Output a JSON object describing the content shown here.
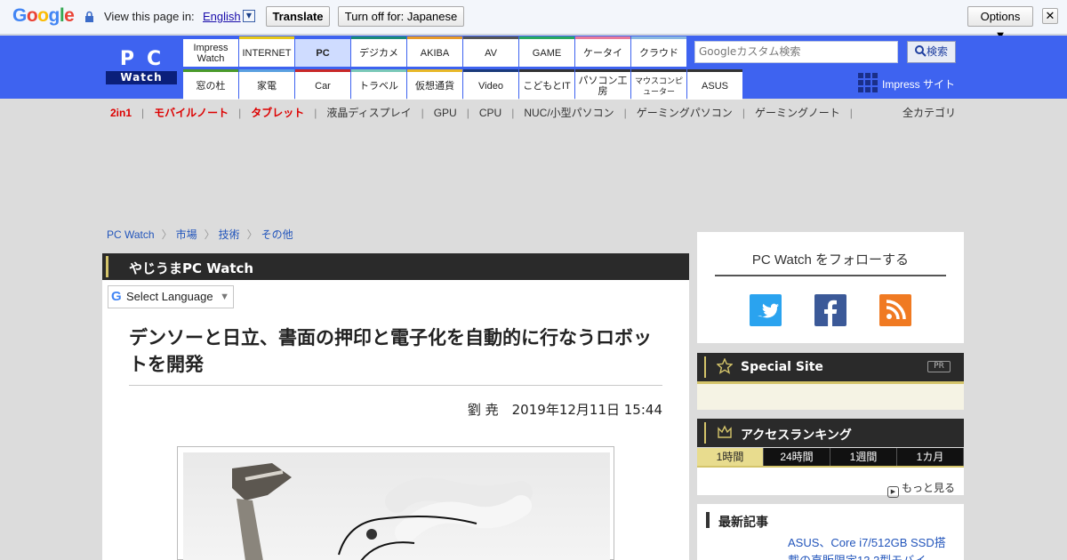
{
  "translate_bar": {
    "logo": "Google",
    "view_label": "View this page in:",
    "language": "English",
    "translate_btn": "Translate",
    "turn_off_btn": "Turn off for: Japanese",
    "options_btn": "Options ▼",
    "close_btn": "✕"
  },
  "header": {
    "logo_top": "PC",
    "logo_bottom": "Watch",
    "nav_top": [
      {
        "label": "Impress Watch",
        "color": "#3e63f0"
      },
      {
        "label": "INTERNET",
        "color": "#e8c818"
      },
      {
        "label": "PC",
        "color": "#3e63f0"
      },
      {
        "label": "デジカメ",
        "color": "#1a8a78"
      },
      {
        "label": "AKIBA",
        "color": "#e89a28"
      },
      {
        "label": "AV",
        "color": "#555555"
      },
      {
        "label": "GAME",
        "color": "#28a860"
      },
      {
        "label": "ケータイ",
        "color": "#e87a9a"
      },
      {
        "label": "クラウド",
        "color": "#8ab8e0"
      }
    ],
    "nav_bottom": [
      {
        "label": "窓の杜",
        "color": "#4a9a2a"
      },
      {
        "label": "家電",
        "color": "#5aa0e0"
      },
      {
        "label": "Car",
        "color": "#c82828"
      },
      {
        "label": "トラベル",
        "color": "#7ac8b8"
      },
      {
        "label": "仮想通貨",
        "color": "#e8b828"
      },
      {
        "label": "Video",
        "color": "#1a3a7a"
      },
      {
        "label": "こどもとIT",
        "color": "#333333"
      },
      {
        "label": "パソコン工房",
        "color": "#333333"
      },
      {
        "label": "マウスコンピューター",
        "color": "#333333"
      },
      {
        "label": "ASUS",
        "color": "#333333"
      }
    ],
    "search_placeholder": "Googleカスタム検索",
    "search_btn": "検索",
    "impress_site": "Impress サイト"
  },
  "categories": [
    {
      "label": "2in1",
      "highlight": true
    },
    {
      "label": "モバイルノート",
      "highlight": true
    },
    {
      "label": "タブレット",
      "highlight": true
    },
    {
      "label": "液晶ディスプレイ",
      "highlight": false
    },
    {
      "label": "GPU",
      "highlight": false
    },
    {
      "label": "CPU",
      "highlight": false
    },
    {
      "label": "NUC/小型パソコン",
      "highlight": false
    },
    {
      "label": "ゲーミングパソコン",
      "highlight": false
    },
    {
      "label": "ゲーミングノート",
      "highlight": false
    }
  ],
  "category_all": "全カテゴリ",
  "breadcrumbs": [
    "PC Watch",
    "市場",
    "技術",
    "その他"
  ],
  "article": {
    "section": "やじうまPC Watch",
    "select_language": "Select Language",
    "headline": "デンソーと日立、書面の押印と電子化を自動的に行なうロボットを開発",
    "byline": "劉 尭　2019年12月11日 15:44"
  },
  "sidebar": {
    "follow_title": "PC Watch をフォローする",
    "special_site": "Special Site",
    "pr": "PR",
    "ranking_title": "アクセスランキング",
    "ranking_tabs": [
      "1時間",
      "24時間",
      "1週間",
      "1カ月"
    ],
    "more": "もっと見る",
    "latest_title": "最新記事",
    "latest_item": "ASUS、Core i7/512GB SSD搭載の直販限定13.3型モバイ"
  }
}
